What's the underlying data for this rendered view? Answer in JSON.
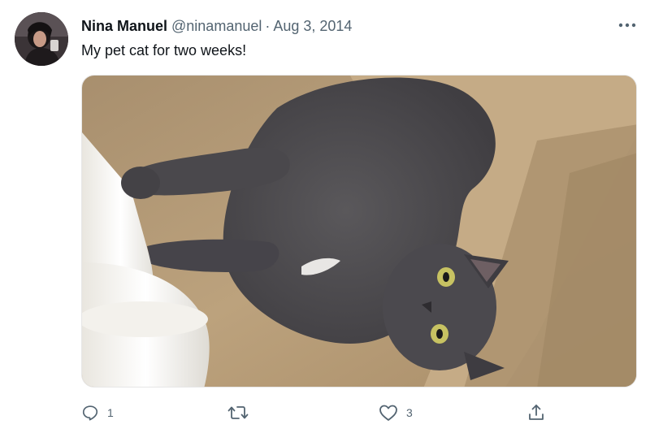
{
  "tweet": {
    "author": {
      "display_name": "Nina Manuel",
      "handle": "@ninamanuel"
    },
    "separator": "·",
    "date": "Aug 3, 2014",
    "text": "My pet cat for two weeks!",
    "media": {
      "alt": "Photo of a grey cat lying on its back on carpeted stairs"
    },
    "actions": {
      "reply": {
        "icon": "reply-icon",
        "count": "1"
      },
      "retweet": {
        "icon": "retweet-icon",
        "count": ""
      },
      "like": {
        "icon": "heart-icon",
        "count": "3"
      },
      "share": {
        "icon": "share-icon"
      }
    },
    "more_icon": "more-icon"
  },
  "colors": {
    "primary_text": "#0f1419",
    "secondary_text": "#536471"
  }
}
